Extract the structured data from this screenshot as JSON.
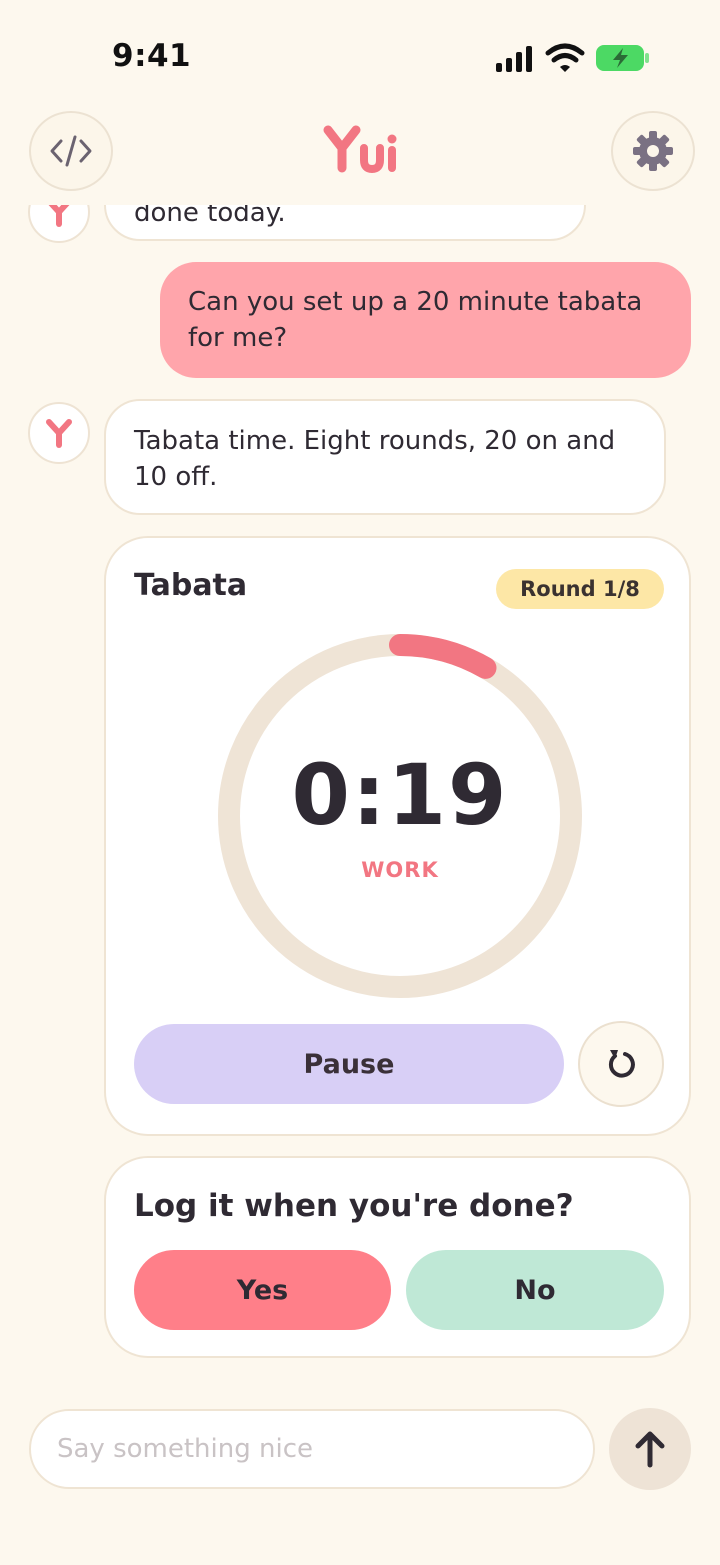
{
  "status_bar": {
    "time": "9:41"
  },
  "header": {
    "logo_text": "Yui"
  },
  "messages": {
    "bot_prev_partial": "done today.",
    "user_1": "Can you set up a 20 minute tabata for me?",
    "bot_1": "Tabata time. Eight rounds, 20 on and 10 off."
  },
  "timer_card": {
    "title": "Tabata",
    "round_badge": "Round 1/8",
    "time_display": "0:19",
    "phase": "WORK",
    "progress_fraction": 0.0833,
    "pause_label": "Pause"
  },
  "log_card": {
    "question": "Log it when you're done?",
    "yes_label": "Yes",
    "no_label": "No"
  },
  "composer": {
    "placeholder": "Say something nice"
  },
  "colors": {
    "background": "#fdf8ee",
    "accent_pink": "#ff7f89",
    "user_bubble": "#ffa5ab",
    "pause_purple": "#d8cff6",
    "no_green": "#bfe8d6",
    "badge_yellow": "#fde7a6",
    "ring_track": "#efe4d6"
  },
  "icons": [
    "code-icon",
    "gear-icon",
    "avatar-logo-icon",
    "reset-icon",
    "arrow-up-icon",
    "cellular-icon",
    "wifi-icon",
    "battery-charging-icon"
  ]
}
